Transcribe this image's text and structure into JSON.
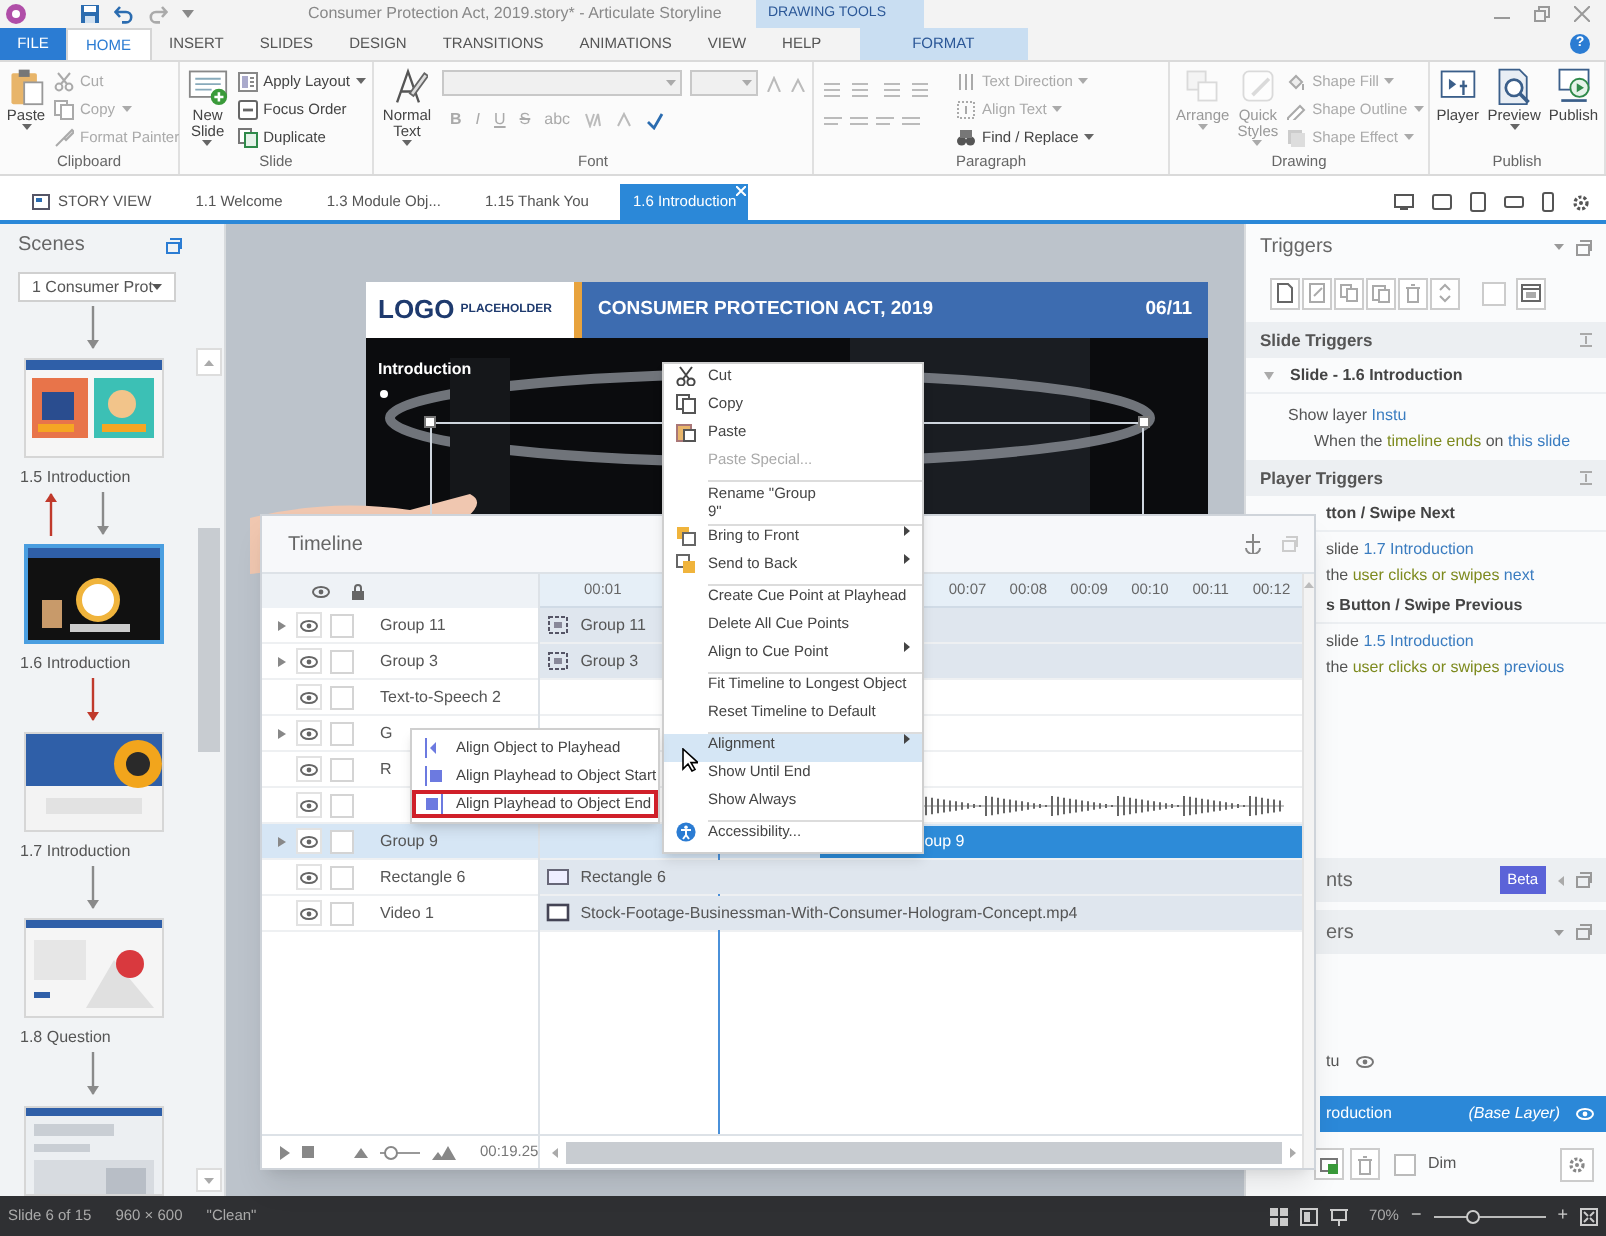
{
  "window": {
    "title": "Consumer Protection Act, 2019.story* -  Articulate Storyline",
    "context_group": "DRAWING TOOLS",
    "help": "?"
  },
  "ribbon_tabs": [
    {
      "label": "FILE",
      "kind": "file",
      "selected": false
    },
    {
      "label": "HOME",
      "kind": "tab",
      "selected": true
    },
    {
      "label": "INSERT",
      "kind": "tab",
      "selected": false
    },
    {
      "label": "SLIDES",
      "kind": "tab",
      "selected": false
    },
    {
      "label": "DESIGN",
      "kind": "tab",
      "selected": false
    },
    {
      "label": "TRANSITIONS",
      "kind": "tab",
      "selected": false
    },
    {
      "label": "ANIMATIONS",
      "kind": "tab",
      "selected": false
    },
    {
      "label": "VIEW",
      "kind": "tab",
      "selected": false
    },
    {
      "label": "HELP",
      "kind": "tab",
      "selected": false
    },
    {
      "label": "FORMAT",
      "kind": "context",
      "selected": false
    }
  ],
  "ribbon_groups": [
    {
      "label": "Clipboard",
      "kind": "standard",
      "large": [
        {
          "label": "Paste",
          "dropdown": true,
          "disabled": false
        }
      ],
      "small": [
        {
          "label": "Cut",
          "dropdown": false,
          "disabled": true
        },
        {
          "label": "Copy",
          "dropdown": true,
          "disabled": true
        },
        {
          "label": "Format Painter",
          "dropdown": false,
          "disabled": true
        }
      ]
    },
    {
      "label": "Slide",
      "kind": "standard",
      "large": [
        {
          "label": "New Slide",
          "dropdown": true,
          "disabled": false
        }
      ],
      "small": [
        {
          "label": "Apply Layout",
          "dropdown": true,
          "disabled": false
        },
        {
          "label": "Focus Order",
          "dropdown": false,
          "disabled": false
        },
        {
          "label": "Duplicate",
          "dropdown": false,
          "disabled": false
        }
      ]
    },
    {
      "label": "Font",
      "kind": "font",
      "large": [
        {
          "label": "Normal Text",
          "dropdown": true,
          "disabled": false
        }
      ],
      "font_buttons": [
        "B",
        "I",
        "U",
        "S",
        "abc"
      ]
    },
    {
      "label": "Paragraph",
      "kind": "paragraph",
      "small": [
        {
          "label": "Text Direction",
          "dropdown": true,
          "disabled": true
        },
        {
          "label": "Align Text",
          "dropdown": true,
          "disabled": true
        },
        {
          "label": "Find / Replace",
          "dropdown": true,
          "disabled": false
        }
      ]
    },
    {
      "label": "Drawing",
      "kind": "standard",
      "large": [
        {
          "label": "Arrange",
          "dropdown": true,
          "disabled": true
        },
        {
          "label": "Quick Styles",
          "dropdown": true,
          "disabled": true
        }
      ],
      "small": [
        {
          "label": "Shape Fill",
          "dropdown": true,
          "disabled": true
        },
        {
          "label": "Shape Outline",
          "dropdown": true,
          "disabled": true
        },
        {
          "label": "Shape Effect",
          "dropdown": true,
          "disabled": true
        }
      ]
    },
    {
      "label": "Publish",
      "kind": "standard",
      "large": [
        {
          "label": "Player",
          "dropdown": false,
          "disabled": false
        },
        {
          "label": "Preview",
          "dropdown": true,
          "disabled": false
        },
        {
          "label": "Publish",
          "dropdown": false,
          "disabled": false
        }
      ]
    }
  ],
  "doc_tabs": [
    {
      "label": "STORY VIEW",
      "kind": "story",
      "selected": false,
      "closable": false
    },
    {
      "label": "1.1 Welcome",
      "kind": "slide",
      "selected": false,
      "closable": false
    },
    {
      "label": "1.3 Module Obj...",
      "kind": "slide",
      "selected": false,
      "closable": false
    },
    {
      "label": "1.15 Thank You",
      "kind": "slide",
      "selected": false,
      "closable": false
    },
    {
      "label": "1.6 Introduction",
      "kind": "slide",
      "selected": true,
      "closable": true
    }
  ],
  "scenes": {
    "title": "Scenes",
    "scene": "1 Consumer Prot",
    "flow": [
      {
        "kind": "arrows",
        "arrows": [
          {
            "kind": "down",
            "color": "#8a8a8a"
          }
        ]
      },
      {
        "kind": "slide",
        "label": "1.5 Introduction",
        "selected": false
      },
      {
        "kind": "arrows",
        "arrows": [
          {
            "kind": "up",
            "color": "#c0392b"
          },
          {
            "kind": "down",
            "color": "#8a8a8a"
          }
        ]
      },
      {
        "kind": "slide",
        "label": "1.6 Introduction",
        "selected": true
      },
      {
        "kind": "arrows",
        "arrows": [
          {
            "kind": "down",
            "color": "#c0392b"
          }
        ]
      },
      {
        "kind": "slide",
        "label": "1.7 Introduction",
        "selected": false
      },
      {
        "kind": "arrows",
        "arrows": [
          {
            "kind": "down",
            "color": "#8a8a8a"
          }
        ]
      },
      {
        "kind": "slide",
        "label": "1.8 Question",
        "selected": false
      },
      {
        "kind": "arrows",
        "arrows": [
          {
            "kind": "down",
            "color": "#8a8a8a"
          }
        ]
      },
      {
        "kind": "slide",
        "selected": false
      }
    ]
  },
  "slide": {
    "logo": "LOGO",
    "logo_sub": "PLACEHOLDER",
    "title": "CONSUMER PROTECTION ACT, 2019",
    "page": "06/11",
    "heading": "Introduction"
  },
  "triggers": {
    "title": "Triggers",
    "toolbar_checkbox": {
      "checked": false
    },
    "sections": [
      {
        "title": "Slide Triggers",
        "groups": [
          {
            "title": "Slide - 1.6 Introduction",
            "expanded": true,
            "triggers": [
              {
                "action": [
                  {
                    "text": "Show layer ",
                    "kind": "plain"
                  },
                  {
                    "text": "Instu",
                    "kind": "target"
                  }
                ],
                "condition": [
                  {
                    "text": "When the ",
                    "kind": "plain"
                  },
                  {
                    "text": "timeline ends",
                    "kind": "event"
                  },
                  {
                    "text": " on ",
                    "kind": "plain"
                  },
                  {
                    "text": "this slide",
                    "kind": "target"
                  }
                ]
              }
            ]
          }
        ]
      },
      {
        "title": "Player Triggers",
        "groups": [
          {
            "title": "tton / Swipe Next",
            "triggers": [
              {
                "action": [
                  {
                    "text": "slide ",
                    "kind": "plain"
                  },
                  {
                    "text": "1.7 Introduction",
                    "kind": "target"
                  }
                ],
                "condition": [
                  {
                    "text": "the ",
                    "kind": "plain"
                  },
                  {
                    "text": "user clicks or swipes",
                    "kind": "event"
                  },
                  {
                    "text": " next",
                    "kind": "target"
                  }
                ]
              }
            ]
          },
          {
            "title": "s Button / Swipe Previous",
            "triggers": [
              {
                "action": [
                  {
                    "text": "slide ",
                    "kind": "plain"
                  },
                  {
                    "text": "1.5 Introduction",
                    "kind": "target"
                  }
                ],
                "condition": [
                  {
                    "text": "the ",
                    "kind": "plain"
                  },
                  {
                    "text": "user clicks or swipes",
                    "kind": "event"
                  },
                  {
                    "text": " previous",
                    "kind": "target"
                  }
                ]
              }
            ]
          }
        ]
      }
    ]
  },
  "states_panel": {
    "title": "nts",
    "badge": "Beta"
  },
  "layers": {
    "title": "ers",
    "items": [
      {
        "name": "tu",
        "selected": false
      },
      {
        "name": "roduction",
        "note": "(Base Layer)",
        "selected": true
      }
    ],
    "dim": {
      "label": "Dim",
      "checked": false
    }
  },
  "timeline": {
    "title": "Timeline",
    "ruler": [
      "00:01",
      "00:07",
      "00:08",
      "00:09",
      "00:10",
      "00:11",
      "00:12"
    ],
    "rows": [
      {
        "name": "Group 11",
        "expandable": true,
        "visible": true,
        "locked": false,
        "selected": false,
        "bar": {
          "kind": "group",
          "label": "Group 11"
        }
      },
      {
        "name": "Group 3",
        "expandable": true,
        "visible": true,
        "locked": false,
        "selected": false,
        "bar": {
          "kind": "group",
          "label": "Group 3"
        }
      },
      {
        "name": "Text-to-Speech 2",
        "expandable": false,
        "visible": true,
        "locked": false,
        "selected": false
      },
      {
        "name": "G",
        "expandable": true,
        "visible": true,
        "locked": false,
        "selected": false
      },
      {
        "name": "R",
        "expandable": false,
        "visible": true,
        "locked": false,
        "selected": false
      },
      {
        "expandable": false,
        "visible": true,
        "locked": false,
        "selected": false,
        "bar": {
          "kind": "audio"
        }
      },
      {
        "name": "Group 9",
        "expandable": true,
        "visible": true,
        "locked": false,
        "selected": true,
        "bar": {
          "kind": "selected",
          "label": "oup 9"
        }
      },
      {
        "name": "Rectangle 6",
        "expandable": false,
        "visible": true,
        "locked": false,
        "selected": false,
        "bar": {
          "kind": "shape",
          "label": "Rectangle 6"
        }
      },
      {
        "name": "Video 1",
        "expandable": false,
        "visible": true,
        "locked": false,
        "selected": false,
        "bar": {
          "kind": "video",
          "label": "Stock-Footage-Businessman-With-Consumer-Hologram-Concept.mp4"
        }
      }
    ],
    "zoom": {
      "level": 0.25
    },
    "time": "00:19.25"
  },
  "context_menu": {
    "items": [
      {
        "kind": "item",
        "label": "Cut",
        "disabled": false,
        "submenu": false,
        "highlighted": false
      },
      {
        "kind": "item",
        "label": "Copy",
        "disabled": false,
        "submenu": false,
        "highlighted": false
      },
      {
        "kind": "item",
        "label": "Paste",
        "disabled": false,
        "submenu": false,
        "highlighted": false
      },
      {
        "kind": "item",
        "label": "Paste Special...",
        "disabled": true,
        "submenu": false,
        "highlighted": false
      },
      {
        "kind": "separator"
      },
      {
        "kind": "wrapped",
        "label": "Rename \"Group 9\"",
        "disabled": false,
        "submenu": false,
        "highlighted": false
      },
      {
        "kind": "separator"
      },
      {
        "kind": "item",
        "label": "Bring to Front",
        "disabled": false,
        "submenu": true,
        "highlighted": false
      },
      {
        "kind": "item",
        "label": "Send to Back",
        "disabled": false,
        "submenu": true,
        "highlighted": false
      },
      {
        "kind": "separator"
      },
      {
        "kind": "item",
        "label": "Create Cue Point at Playhead",
        "disabled": false,
        "submenu": false,
        "highlighted": false
      },
      {
        "kind": "item",
        "label": "Delete All Cue Points",
        "disabled": false,
        "submenu": false,
        "highlighted": false
      },
      {
        "kind": "item",
        "label": "Align to Cue Point",
        "disabled": false,
        "submenu": true,
        "highlighted": false
      },
      {
        "kind": "separator"
      },
      {
        "kind": "item",
        "label": "Fit Timeline to Longest Object",
        "disabled": false,
        "submenu": false,
        "highlighted": false
      },
      {
        "kind": "item",
        "label": "Reset Timeline to Default",
        "disabled": false,
        "submenu": false,
        "highlighted": false
      },
      {
        "kind": "separator"
      },
      {
        "kind": "item",
        "label": "Alignment",
        "disabled": false,
        "submenu": true,
        "highlighted": true
      },
      {
        "kind": "item",
        "label": "Show Until End",
        "disabled": false,
        "submenu": false,
        "highlighted": false
      },
      {
        "kind": "item",
        "label": "Show Always",
        "disabled": false,
        "submenu": false,
        "highlighted": false
      },
      {
        "kind": "separator"
      },
      {
        "kind": "item",
        "label": "Accessibility...",
        "disabled": false,
        "submenu": false,
        "highlighted": false
      }
    ]
  },
  "submenu": {
    "items": [
      {
        "label": "Align Object to Playhead",
        "outlined": false
      },
      {
        "label": "Align Playhead to Object Start",
        "outlined": false
      },
      {
        "label": "Align Playhead to Object End",
        "outlined": true
      }
    ]
  },
  "status_bar": {
    "slide": "Slide 6 of 15",
    "size": "960 × 600",
    "theme": "\"Clean\"",
    "zoom": "70%",
    "minus": "−",
    "plus": "+",
    "zoom_slider": {
      "level": 0.35
    }
  }
}
